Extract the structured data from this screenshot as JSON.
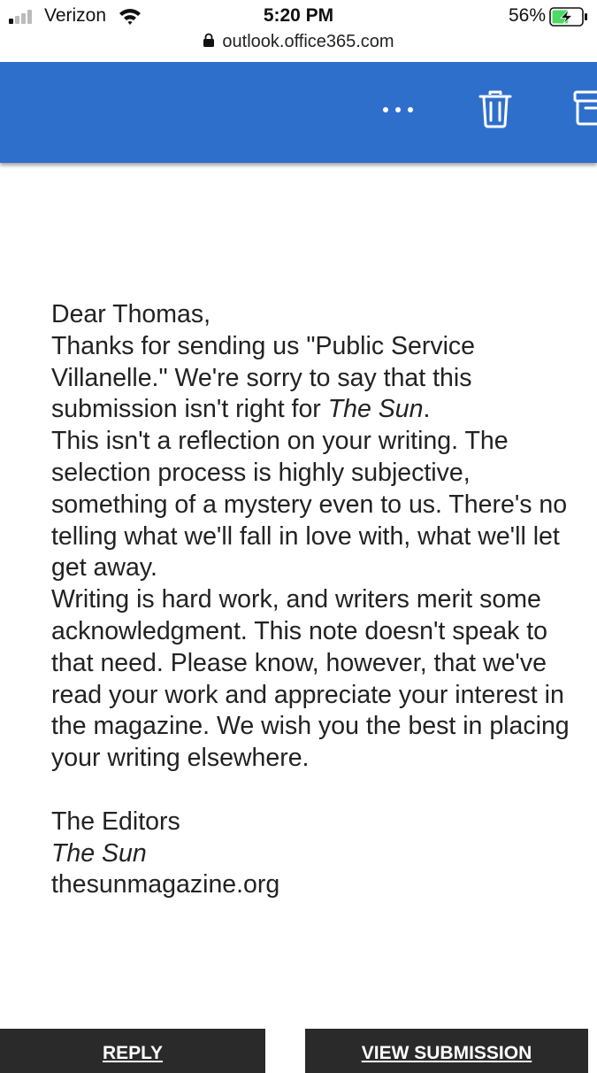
{
  "status_bar": {
    "carrier": "Verizon",
    "time": "5:20 PM",
    "battery_percent": "56%",
    "battery_level": 0.56,
    "battery_color": "#4cd964",
    "signal_bars_active": 1
  },
  "browser": {
    "url": "outlook.office365.com"
  },
  "toolbar": {
    "background_color": "#2f6fcc",
    "icons": [
      "more-icon",
      "trash-icon",
      "archive-icon"
    ]
  },
  "email": {
    "greeting": "Dear Thomas,",
    "para1_part1": "Thanks for sending us \"Public Service Villanelle.\" We're sorry to say that this submission isn't right for ",
    "para1_magazine": "The Sun",
    "para1_part2": ".",
    "para2": "This isn't a reflection on your writing. The selection process is highly subjective, something of a mystery even to us. There's no telling what we'll fall in love with, what we'll let get away.",
    "para3": "Writing is hard work, and writers merit some acknowledgment. This note doesn't speak to that need. Please know, however, that we've read your work and appreciate your interest in the magazine. We wish you the best in placing your writing elsewhere.",
    "signature_name": "The Editors",
    "signature_magazine": "The Sun",
    "signature_site": "thesunmagazine.org"
  },
  "buttons": {
    "reply_label": "REPLY",
    "view_submission_label": "VIEW SUBMISSION"
  }
}
